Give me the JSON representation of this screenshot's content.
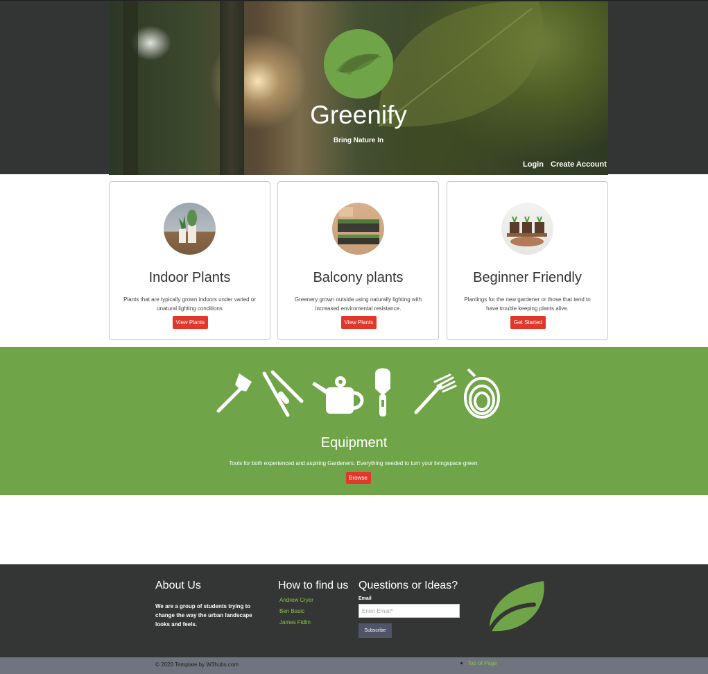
{
  "header": {
    "brand_title": "Greenify",
    "tagline": "Bring Nature In",
    "nav": {
      "login": "Login",
      "create_account": "Create Account"
    }
  },
  "cards": [
    {
      "title": "Indoor Plants",
      "text": "Plants that are typically grown indoors under varied or unatural lighting conditions",
      "button": "View Plants"
    },
    {
      "title": "Balcony plants",
      "text": "Greenery grown outside using naturally lighting with increased enviromental resistance.",
      "button": "View Plants"
    },
    {
      "title": "Beginner Friendly",
      "text": "Plantings for the new gardener or those that tend to have trouble keeping plants alive.",
      "button": "Get Started"
    }
  ],
  "equipment": {
    "title": "Equipment",
    "text": "Tools for both experienced and aspiring Gardeners. Everything needed to turn your livingspace green.",
    "button": "Browse",
    "icons": [
      "shovel-icon",
      "shears-icon",
      "watering-can-icon",
      "trowel-icon",
      "rake-icon",
      "hose-icon"
    ]
  },
  "footer": {
    "about": {
      "heading": "About Us",
      "text": "We are a group of students trying to change the way the urban landscape looks and feels."
    },
    "find": {
      "heading": "How to find us",
      "links": [
        "Andrew Cryer",
        "Ben Basic",
        "James Fidlin"
      ]
    },
    "questions": {
      "heading": "Questions or Ideas?",
      "email_label": "Email",
      "email_placeholder": "Enter Email*",
      "subscribe": "Subscribe"
    },
    "copyright": "© 2020 Template by W3hubs.com",
    "top_link": "Top of Page"
  },
  "colors": {
    "brand_green": "#6fa548",
    "accent_red": "#e2382c",
    "dark": "#343535",
    "link_green": "#8bc34a"
  }
}
